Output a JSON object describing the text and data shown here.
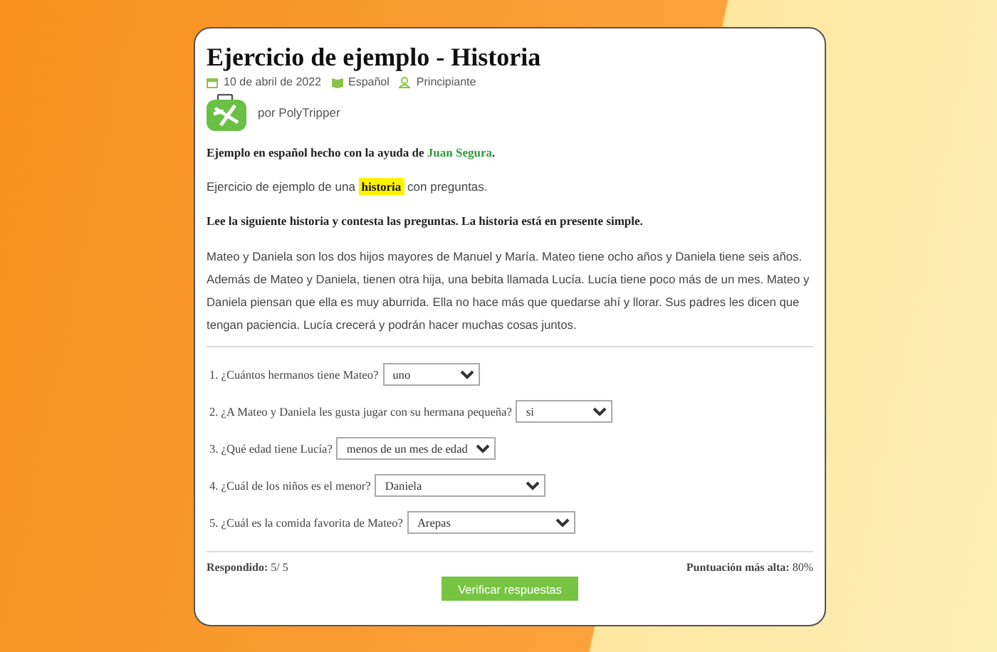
{
  "title": "Ejercicio de ejemplo - Historia",
  "meta": {
    "date": "10 de abril de 2022",
    "language": "Español",
    "level": "Principiante"
  },
  "author": "por PolyTripper",
  "credit": {
    "text": "Ejemplo en español hecho con la ayuda de ",
    "link": "Juan Segura",
    "end": "."
  },
  "intro": {
    "before": "Ejercicio de ejemplo de una ",
    "highlight": "historia",
    "after": " con preguntas."
  },
  "instruction": "Lee la siguiente historia y contesta las preguntas. La historia está en presente simple.",
  "story": "Mateo y Daniela son los dos hijos mayores de Manuel y María. Mateo tiene ocho años y Daniela tiene seis años. Además de Mateo y Daniela, tienen otra hija, una bebita llamada Lucía. Lucía tiene poco más de un mes. Mateo y Daniela piensan que ella es muy aburrida. Ella no hace más que quedarse ahí y llorar. Sus padres les dicen que tengan paciencia. Lucía crecerá y podrán hacer muchas cosas juntos.",
  "questions": [
    {
      "label": "1. ¿Cuántos hermanos tiene Mateo?",
      "answer": "uno"
    },
    {
      "label": "2. ¿A Mateo y Daniela les gusta jugar con su hermana pequeña?",
      "answer": "si"
    },
    {
      "label": "3. ¿Qué edad tiene Lucía?",
      "answer": "menos de un mes de edad"
    },
    {
      "label": "4. ¿Cuál de los niños es el menor?",
      "answer": "Daniela"
    },
    {
      "label": "5. ¿Cuál es la comida favorita de Mateo?",
      "answer": "Arepas"
    }
  ],
  "answered": "**Respondido:** 5/ 5",
  "high_score": "**Puntuación más alta:** 80%",
  "button": "Verificar respuestas"
}
